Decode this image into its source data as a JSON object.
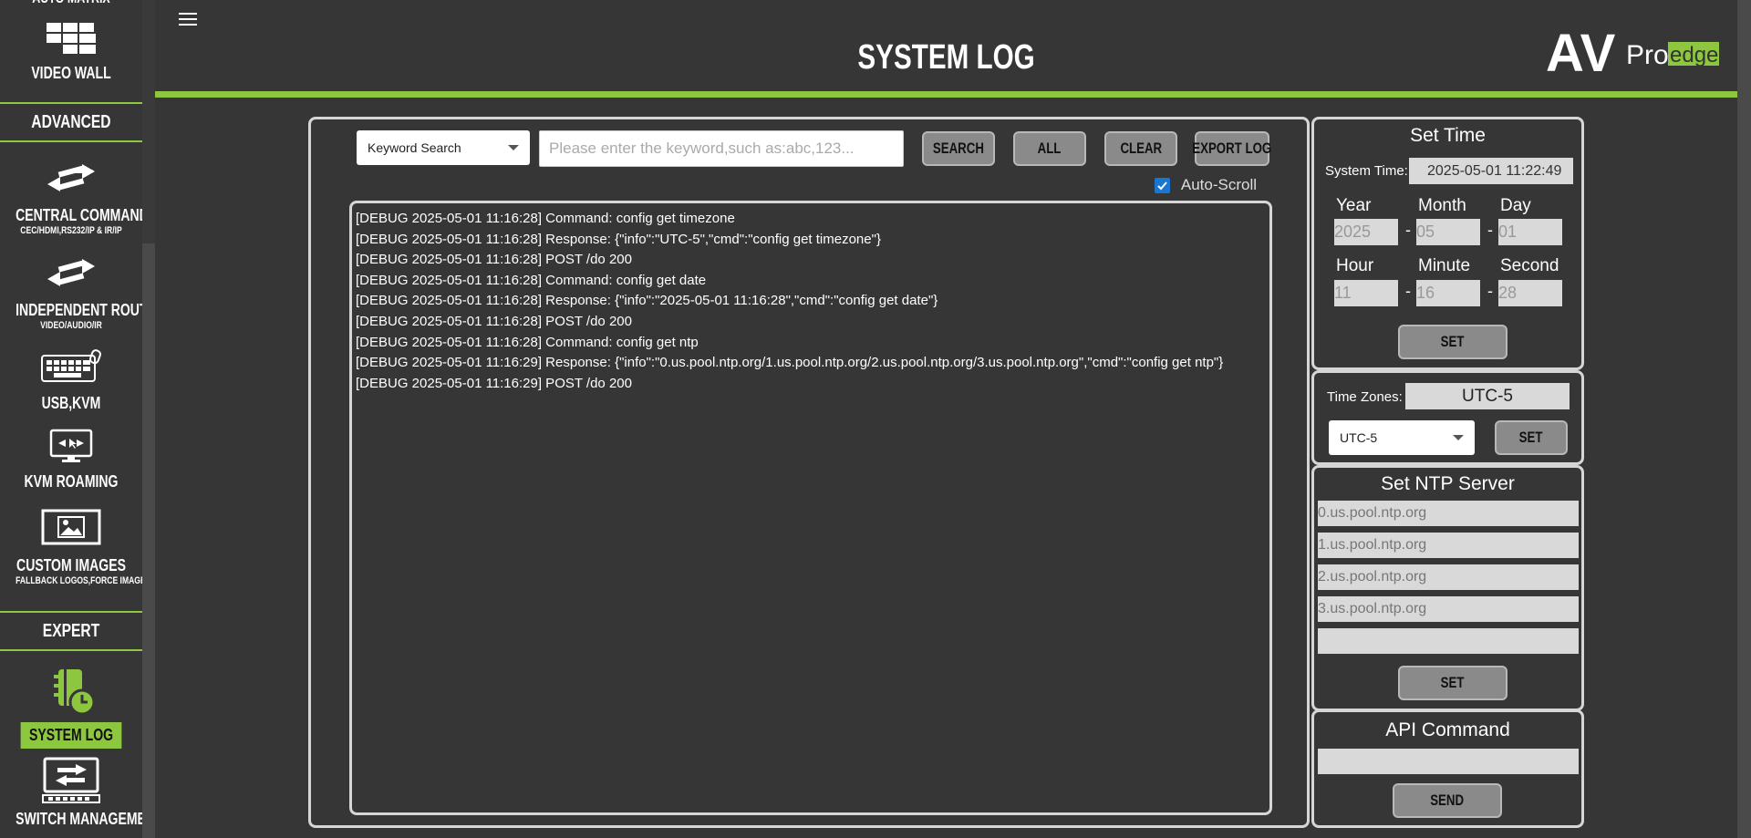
{
  "sidebar": {
    "auto_matrix_partial": "AUTO MATRIX",
    "video_wall": "VIDEO WALL",
    "advanced": "ADVANCED",
    "central_command": "CENTRAL COMMAND",
    "central_command_sub": "CEC/HDMI,RS232/IP & IR/IP",
    "independent_routing": "INDEPENDENT ROUTING",
    "independent_routing_sub": "VIDEO/AUDIO/IR",
    "usb_kvm": "USB,KVM",
    "kvm_roaming": "KVM ROAMING",
    "custom_images": "CUSTOM IMAGES",
    "custom_images_sub": "FALLBACK LOGOS,FORCE IMAGES",
    "expert": "EXPERT",
    "system_log": "SYSTEM LOG",
    "switch_management": "SWITCH MANAGEMENT"
  },
  "header": {
    "title": "SYSTEM LOG",
    "logo_av": "AV",
    "logo_pro": "Pro",
    "logo_edge": "edge"
  },
  "toolbar": {
    "filter_value": "Keyword Search",
    "search_placeholder": "Please enter the keyword,such as:abc,123...",
    "search_label": "SEARCH",
    "all_label": "ALL",
    "clear_label": "CLEAR",
    "export_label": "EXPORT LOG",
    "autoscroll_label": "Auto-Scroll"
  },
  "log_lines": [
    "[DEBUG 2025-05-01 11:16:28] Command: config get timezone",
    "[DEBUG 2025-05-01 11:16:28] Response: {\"info\":\"UTC-5\",\"cmd\":\"config get timezone\"}",
    "[DEBUG 2025-05-01 11:16:28] POST /do 200",
    "[DEBUG 2025-05-01 11:16:28] Command: config get date",
    "[DEBUG 2025-05-01 11:16:28] Response: {\"info\":\"2025-05-01 11:16:28\",\"cmd\":\"config get date\"}",
    "[DEBUG 2025-05-01 11:16:28] POST /do 200",
    "[DEBUG 2025-05-01 11:16:28] Command: config get ntp",
    "[DEBUG 2025-05-01 11:16:29] Response: {\"info\":\"0.us.pool.ntp.org/1.us.pool.ntp.org/2.us.pool.ntp.org/3.us.pool.ntp.org\",\"cmd\":\"config get ntp\"}",
    "[DEBUG 2025-05-01 11:16:29] POST /do 200"
  ],
  "set_time": {
    "title": "Set Time",
    "system_time_label": "System Time:",
    "system_time_value": "2025-05-01 11:22:49",
    "year_label": "Year",
    "month_label": "Month",
    "day_label": "Day",
    "hour_label": "Hour",
    "minute_label": "Minute",
    "second_label": "Second",
    "year": "2025",
    "month": "05",
    "day": "01",
    "hour": "11",
    "minute": "16",
    "second": "28",
    "separator": "-",
    "set_label": "SET"
  },
  "time_zone": {
    "label": "Time Zones:",
    "current": "UTC-5",
    "selected": "UTC-5",
    "set_label": "SET"
  },
  "ntp": {
    "title": "Set NTP Server",
    "servers": [
      "0.us.pool.ntp.org",
      "1.us.pool.ntp.org",
      "2.us.pool.ntp.org",
      "3.us.pool.ntp.org",
      ""
    ],
    "set_label": "SET"
  },
  "api": {
    "title": "API Command",
    "value": "",
    "send_label": "SEND"
  },
  "colors": {
    "accent": "#8dc63f",
    "background": "#363636",
    "button": "#8a8a8a",
    "checkbox": "#1976d2"
  }
}
